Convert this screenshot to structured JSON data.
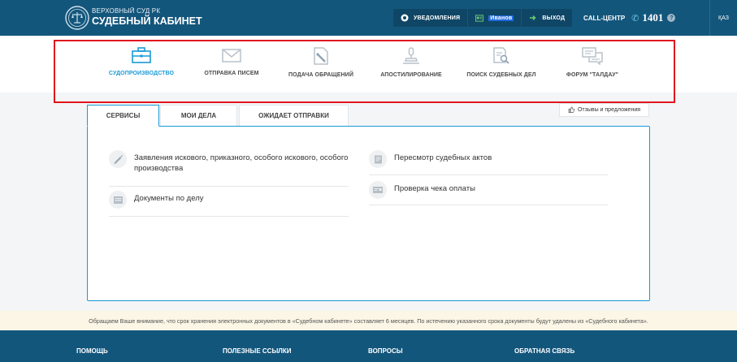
{
  "header": {
    "brand_sub": "ВЕРХОВНЫЙ СУД РК",
    "brand_main": "СУДЕБНЫЙ КАБИНЕТ",
    "notifications_label": "УВЕДОМЛЕНИЯ",
    "user_name": "Иванов",
    "logout_label": "ВЫХОД",
    "callcenter_label": "CALL-ЦЕНТР",
    "callcenter_number": "1401",
    "lang_label": "ҚАЗ"
  },
  "nav": {
    "items": [
      {
        "label": "СУДОПРОИЗВОДСТВО",
        "icon": "briefcase-icon",
        "active": true
      },
      {
        "label": "ОТПРАВКА ПИСЕМ",
        "icon": "envelope-icon"
      },
      {
        "label": "ПОДАЧА ОБРАЩЕНИЙ",
        "icon": "document-pencil-icon"
      },
      {
        "label": "АПОСТИЛИРОВАНИЕ",
        "icon": "stamp-icon"
      },
      {
        "label": "ПОИСК СУДЕБНЫХ ДЕЛ",
        "icon": "document-search-icon"
      },
      {
        "label": "ФОРУМ \"ТАЛДАУ\"",
        "icon": "chat-icon"
      }
    ]
  },
  "tabs": [
    {
      "label": "СЕРВИСЫ",
      "active": true
    },
    {
      "label": "МОИ ДЕЛА"
    },
    {
      "label": "ОЖИДАЕТ ОТПРАВКИ"
    }
  ],
  "feedback_label": "Отзывы и предложения",
  "services": {
    "left": [
      {
        "label": "Заявления искового, приказного, особого искового, особого производства",
        "icon": "pen-icon"
      },
      {
        "label": "Документы по делу",
        "icon": "folder-icon"
      }
    ],
    "right": [
      {
        "label": "Пересмотр судебных актов",
        "icon": "review-icon"
      },
      {
        "label": "Проверка чека оплаты",
        "icon": "receipt-icon"
      }
    ]
  },
  "notice": "Обращаем Ваше внимание, что срок хранения электронных документов в «Судебном кабинете» составляет 6 месяцев. По истечению указанного срока документы будут удалены из «Судебного кабинета».",
  "footer": {
    "links": [
      "ПОМОЩЬ",
      "ПОЛЕЗНЫЕ ССЫЛКИ",
      "ВОПРОСЫ",
      "ОБРАТНАЯ СВЯЗЬ"
    ]
  },
  "colors": {
    "primary": "#13567c",
    "accent": "#1a9ad6",
    "highlight_outline": "#e0141e"
  }
}
